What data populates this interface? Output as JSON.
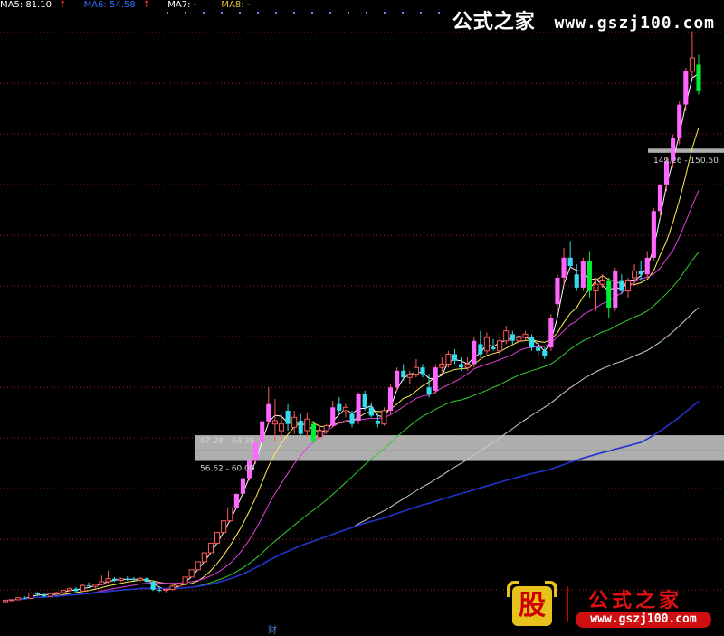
{
  "legend": [
    {
      "label": "MA5: 81.10",
      "arrow": "↑",
      "color": "#ffffff"
    },
    {
      "label": "MA6: 54.58",
      "arrow": "↑",
      "color": "#2c6cff"
    },
    {
      "label": "MA7: -",
      "arrow": "",
      "color": "#ffffff"
    },
    {
      "label": "MA8: -",
      "arrow": "",
      "color": "#e0c040"
    }
  ],
  "watermark": {
    "top_name": "公式之家",
    "top_url": "www.gszj100.com",
    "logo_char": "股",
    "logo_name": "公式之家",
    "logo_url": "www.gszj100.com"
  },
  "footer_label": "财",
  "colors": {
    "up": "#ff5a5a",
    "up_big": "#ff66ff",
    "down": "#33ddee",
    "down_big": "#00ee33",
    "ma_fast": "#ffffff",
    "ma_mid": "#ffee55",
    "ma_slow": "#e040e0",
    "ma_long1": "#33cc33",
    "ma_long2": "#cccccc",
    "ma_long3": "#2233cc",
    "grid": "#aa2222",
    "zone": "#cccccc"
  },
  "chart_data": {
    "type": "candlestick",
    "title": "",
    "xlabel": "",
    "ylabel": "",
    "grid": true,
    "ylim": [
      10,
      190
    ],
    "candles": [
      [
        14.6,
        15.1,
        14.4,
        15.0
      ],
      [
        15.0,
        15.3,
        14.8,
        15.2
      ],
      [
        15.2,
        15.9,
        15.0,
        15.8
      ],
      [
        15.8,
        16.2,
        15.4,
        15.6
      ],
      [
        15.6,
        17.4,
        15.5,
        17.2
      ],
      [
        17.2,
        17.5,
        16.6,
        16.8
      ],
      [
        16.8,
        17.0,
        16.0,
        16.2
      ],
      [
        16.2,
        17.2,
        16.0,
        17.0
      ],
      [
        17.0,
        17.5,
        16.6,
        17.3
      ],
      [
        17.3,
        18.2,
        17.0,
        18.0
      ],
      [
        18.0,
        18.8,
        17.7,
        18.5
      ],
      [
        18.5,
        19.0,
        17.6,
        17.8
      ],
      [
        17.8,
        19.8,
        17.6,
        19.5
      ],
      [
        19.5,
        20.4,
        19.1,
        19.2
      ],
      [
        19.2,
        20.0,
        18.6,
        19.8
      ],
      [
        19.8,
        22.4,
        19.5,
        20.6
      ],
      [
        20.6,
        23.9,
        20.2,
        21.5
      ],
      [
        21.5,
        22.0,
        20.6,
        21.0
      ],
      [
        21.0,
        21.8,
        20.5,
        21.5
      ],
      [
        21.5,
        22.2,
        20.9,
        21.4
      ],
      [
        21.4,
        22.0,
        20.8,
        21.1
      ],
      [
        21.1,
        22.0,
        20.7,
        21.6
      ],
      [
        21.6,
        21.9,
        20.4,
        20.6
      ],
      [
        20.6,
        20.9,
        17.8,
        18.2
      ],
      [
        18.2,
        18.6,
        17.5,
        18.0
      ],
      [
        18.0,
        18.5,
        17.4,
        18.3
      ],
      [
        18.3,
        19.5,
        18.0,
        19.3
      ],
      [
        19.3,
        20.2,
        19.0,
        20.0
      ],
      [
        20.0,
        22.1,
        19.8,
        22.0
      ],
      [
        22.0,
        24.3,
        21.8,
        24.2
      ],
      [
        24.2,
        26.6,
        24.0,
        26.6
      ],
      [
        26.6,
        29.3,
        26.5,
        29.3
      ],
      [
        29.3,
        32.2,
        29.2,
        32.2
      ],
      [
        32.2,
        35.5,
        32.0,
        35.4
      ],
      [
        35.4,
        38.9,
        35.2,
        38.9
      ],
      [
        38.9,
        42.8,
        38.6,
        42.8
      ],
      [
        42.8,
        47.1,
        42.5,
        47.0
      ],
      [
        47.0,
        51.7,
        46.5,
        51.7
      ],
      [
        51.7,
        56.9,
        51.0,
        56.9
      ],
      [
        56.9,
        62.6,
        56.0,
        62.5
      ],
      [
        62.5,
        69.0,
        61.5,
        68.8
      ],
      [
        68.8,
        79.0,
        68.0,
        74.0
      ],
      [
        68.0,
        75.5,
        63.0,
        69.0
      ],
      [
        66.0,
        71.0,
        63.0,
        68.0
      ],
      [
        72.0,
        74.0,
        66.0,
        68.0
      ],
      [
        67.0,
        72.0,
        65.0,
        70.0
      ],
      [
        69.0,
        71.0,
        64.0,
        65.0
      ],
      [
        66.0,
        71.5,
        64.0,
        69.5
      ],
      [
        68.0,
        69.0,
        62.0,
        63.0
      ],
      [
        64.0,
        67.0,
        63.5,
        66.0
      ],
      [
        66.0,
        68.0,
        65.0,
        67.5
      ],
      [
        67.5,
        75.0,
        67.0,
        73.0
      ],
      [
        74.0,
        76.0,
        71.0,
        72.0
      ],
      [
        72.0,
        74.0,
        70.0,
        73.0
      ],
      [
        71.0,
        72.0,
        67.0,
        68.0
      ],
      [
        69.0,
        77.5,
        68.0,
        77.0
      ],
      [
        77.0,
        78.0,
        72.0,
        73.0
      ],
      [
        73.0,
        74.5,
        70.0,
        70.5
      ],
      [
        69.0,
        71.0,
        67.0,
        68.0
      ],
      [
        68.0,
        73.0,
        67.5,
        72.0
      ],
      [
        72.0,
        80.0,
        71.0,
        79.0
      ],
      [
        79.0,
        85.0,
        78.0,
        84.0
      ],
      [
        84.0,
        86.0,
        81.0,
        82.0
      ],
      [
        82.0,
        84.0,
        80.0,
        83.0
      ],
      [
        83.0,
        87.5,
        82.0,
        85.0
      ],
      [
        85.0,
        86.0,
        82.0,
        83.0
      ],
      [
        79.0,
        83.0,
        76.0,
        77.0
      ],
      [
        78.0,
        86.0,
        77.0,
        85.0
      ],
      [
        85.0,
        88.0,
        83.5,
        86.0
      ],
      [
        86.0,
        90.0,
        85.0,
        89.0
      ],
      [
        89.0,
        90.5,
        86.0,
        87.0
      ],
      [
        86.0,
        88.0,
        84.0,
        85.0
      ],
      [
        85.0,
        88.0,
        84.0,
        86.0
      ],
      [
        86.0,
        94.0,
        85.0,
        93.0
      ],
      [
        92.0,
        96.0,
        88.0,
        89.0
      ],
      [
        90.0,
        95.5,
        89.0,
        94.0
      ],
      [
        91.0,
        93.5,
        90.0,
        90.5
      ],
      [
        90.0,
        94.0,
        88.5,
        93.0
      ],
      [
        93.0,
        97.5,
        92.0,
        96.0
      ],
      [
        95.0,
        96.0,
        92.0,
        93.0
      ],
      [
        93.0,
        95.0,
        92.0,
        94.0
      ],
      [
        94.0,
        96.0,
        93.0,
        95.0
      ],
      [
        94.0,
        95.0,
        90.0,
        91.0
      ],
      [
        91.0,
        93.0,
        88.0,
        90.0
      ],
      [
        90.0,
        91.0,
        87.5,
        88.5
      ],
      [
        91.0,
        101.0,
        90.0,
        100.0
      ],
      [
        104.0,
        113.0,
        102.0,
        112.0
      ],
      [
        112.0,
        121.0,
        110.0,
        118.0
      ],
      [
        118.0,
        123.0,
        115.0,
        115.5
      ],
      [
        113.0,
        116.0,
        108.0,
        109.0
      ],
      [
        109.0,
        118.0,
        108.0,
        117.0
      ],
      [
        117.0,
        120.0,
        106.0,
        108.0
      ],
      [
        108.0,
        112.0,
        102.0,
        110.0
      ],
      [
        110.0,
        113.0,
        109.0,
        111.0
      ],
      [
        111.0,
        112.0,
        100.0,
        103.0
      ],
      [
        103.0,
        115.0,
        102.0,
        114.0
      ],
      [
        111.0,
        113.0,
        107.0,
        108.0
      ],
      [
        108.0,
        112.0,
        106.0,
        111.0
      ],
      [
        112.0,
        116.0,
        110.0,
        114.0
      ],
      [
        114.0,
        117.0,
        111.0,
        113.0
      ],
      [
        113.0,
        120.0,
        112.0,
        118.0
      ],
      [
        118.0,
        133.0,
        117.0,
        132.0
      ],
      [
        132.0,
        140.0,
        130.0,
        140.0
      ],
      [
        140.0,
        148.0,
        138.0,
        147.0
      ],
      [
        147.0,
        155.0,
        145.0,
        154.0
      ],
      [
        154.0,
        165.0,
        152.0,
        164.0
      ],
      [
        164.0,
        175.0,
        162.0,
        174.0
      ],
      [
        174.0,
        186.0,
        172.0,
        178.0
      ],
      [
        176.0,
        179.0,
        167.0,
        168.0
      ]
    ],
    "zones": [
      {
        "low": 60.0,
        "high": 64.36,
        "text": "67.28 - 64.36"
      },
      {
        "low": 56.62,
        "high": 60.0,
        "text": "56.62 - 60.00"
      },
      {
        "low": 149.26,
        "high": 150.5,
        "text": "149.26 - 150.50"
      }
    ]
  }
}
